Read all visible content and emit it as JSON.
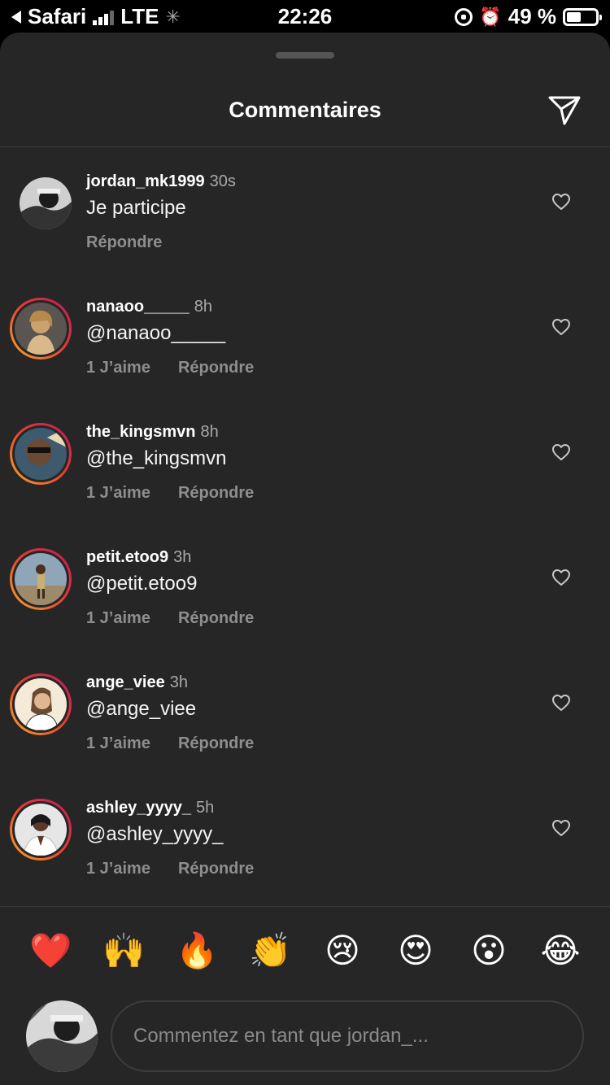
{
  "status_bar": {
    "back_app": "Safari",
    "carrier": "LTE",
    "time": "22:26",
    "battery": "49 %"
  },
  "header": {
    "title": "Commentaires",
    "send_icon": "paper-plane-icon"
  },
  "comments": [
    {
      "username": "jordan_mk1999",
      "time": "30s",
      "text": "Je participe",
      "likes": "",
      "reply": "Répondre",
      "story_ring": false
    },
    {
      "username": "nanaoo_____",
      "time": "8h",
      "text": "@nanaoo_____",
      "likes": "1 J’aime",
      "reply": "Répondre",
      "story_ring": true
    },
    {
      "username": "the_kingsmvn",
      "time": "8h",
      "text": "@the_kingsmvn",
      "likes": "1 J’aime",
      "reply": "Répondre",
      "story_ring": true
    },
    {
      "username": "petit.etoo9",
      "time": "3h",
      "text": "@petit.etoo9",
      "likes": "1 J’aime",
      "reply": "Répondre",
      "story_ring": true
    },
    {
      "username": "ange_viee",
      "time": "3h",
      "text": "@ange_viee",
      "likes": "1 J’aime",
      "reply": "Répondre",
      "story_ring": true
    },
    {
      "username": "ashley_yyyy_",
      "time": "5h",
      "text": "@ashley_yyyy_",
      "likes": "1 J’aime",
      "reply": "Répondre",
      "story_ring": true
    }
  ],
  "emojis": [
    "❤️",
    "🙌",
    "🔥",
    "👏",
    "😢",
    "😍",
    "😮",
    "😂"
  ],
  "composer": {
    "placeholder": "Commentez en tant que jordan_..."
  },
  "colors": {
    "sheet_bg": "#262626",
    "story_ring_start": "#f9a825",
    "story_ring_end": "#c2185b",
    "muted_text": "#8e8e8e"
  }
}
